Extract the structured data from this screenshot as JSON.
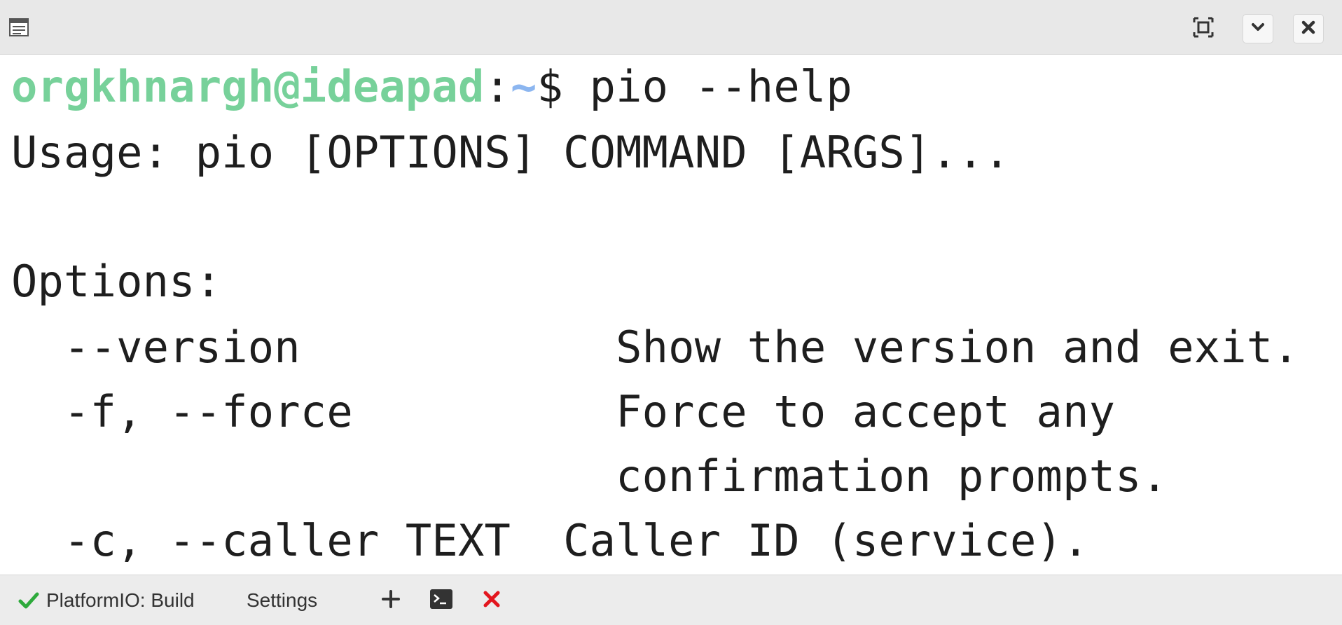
{
  "titlebar": {
    "menu_icon": "menu-icon",
    "maximize_icon": "maximize-icon",
    "minimize_icon": "chevron-down-icon",
    "close_icon": "close-icon"
  },
  "terminal": {
    "prompt": {
      "user_host": "orgkhnargh@ideapad",
      "colon": ":",
      "path": "~",
      "dollar": "$ ",
      "command": "pio --help"
    },
    "output": [
      "Usage: pio [OPTIONS] COMMAND [ARGS]...",
      "",
      "Options:",
      "  --version            Show the version and exit.",
      "  -f, --force          Force to accept any",
      "                       confirmation prompts.",
      "  -c, --caller TEXT  Caller ID (service)."
    ],
    "colors": {
      "user_host": "#77d19a",
      "path": "#8cb6f0",
      "text": "#1e1e1e"
    }
  },
  "statusbar": {
    "build_label": "PlatformIO: Build",
    "settings_label": "Settings",
    "check_color": "#2eaa3c",
    "kill_color": "#e3161e",
    "icons": [
      "check-icon",
      "plus-icon",
      "terminal-icon",
      "kill-terminal-icon"
    ]
  }
}
